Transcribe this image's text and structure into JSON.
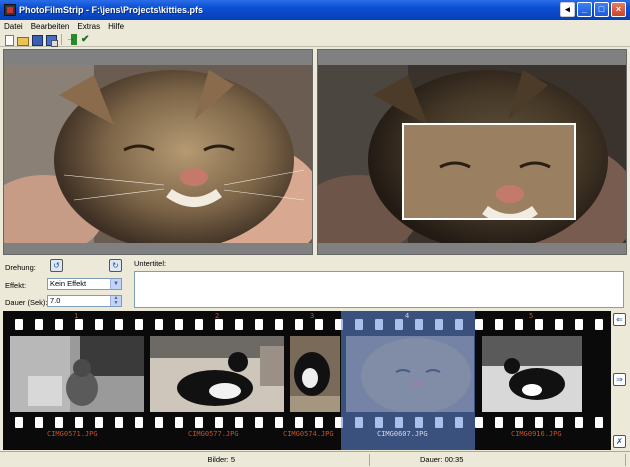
{
  "window": {
    "title": "PhotoFilmStrip - F:\\jens\\Projects\\kitties.pfs"
  },
  "menu": [
    "Datei",
    "Bearbeiten",
    "Extras",
    "Hilfe"
  ],
  "toolbar_icons": [
    "new-icon",
    "open-icon",
    "save-icon",
    "save-as-icon",
    "export-icon",
    "check-icon"
  ],
  "props": {
    "rotation_label": "Drehung:",
    "effect_label": "Effekt:",
    "effect_value": "Kein Effekt",
    "duration_label": "Dauer (Sek):",
    "duration_value": "7.0",
    "subtitle_label": "Untertitel:"
  },
  "filmstrip": {
    "frames": [
      {
        "number": "1",
        "name": "CIMG0571.JPG"
      },
      {
        "number": "2",
        "name": "CIMG0577.JPG"
      },
      {
        "number": "3",
        "name": "CIMG0574.JPG"
      },
      {
        "number": "4",
        "name": "CIMG0607.JPG"
      },
      {
        "number": "5",
        "name": "CIMG0916.JPG"
      }
    ],
    "selected_index": 3
  },
  "status": {
    "count": "Bilder: 5",
    "duration": "Dauer: 00:35"
  },
  "colors": {
    "title_bar": "#0a4fd1",
    "frame_label": "#c8502a",
    "selection": "#648cdc"
  }
}
